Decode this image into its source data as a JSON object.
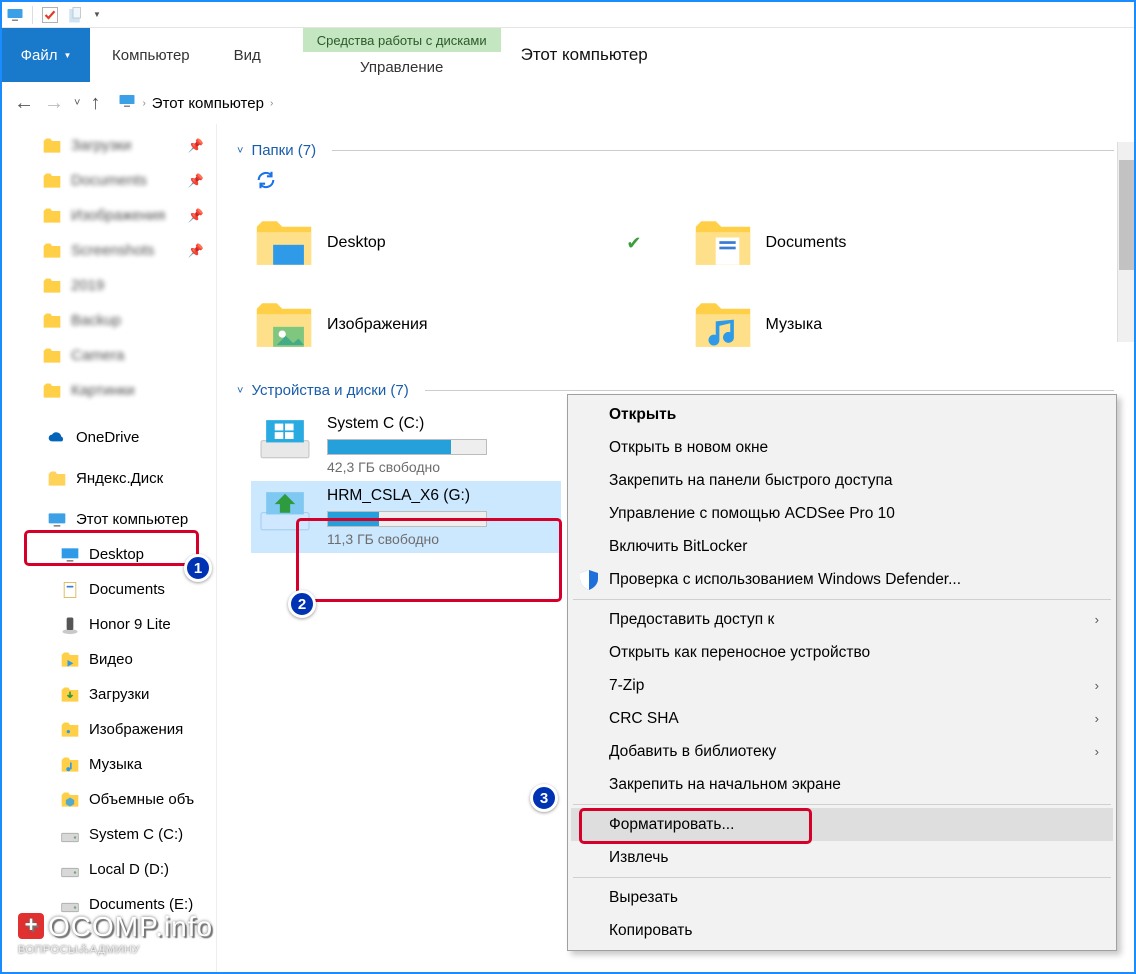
{
  "qab": {
    "icons": [
      "pc",
      "check",
      "paste"
    ]
  },
  "ribbon": {
    "file": "Файл",
    "tabs": [
      "Компьютер",
      "Вид"
    ],
    "context_title": "Средства работы с дисками",
    "context_tab": "Управление",
    "window_title": "Этот компьютер"
  },
  "breadcrumb": {
    "root": "Этот компьютер"
  },
  "sidebar": {
    "quick": [
      {
        "label": "Загрузки",
        "icon": "folder",
        "pinned": true,
        "blur": true
      },
      {
        "label": "Documents",
        "icon": "folder",
        "pinned": true,
        "blur": true
      },
      {
        "label": "Изображения",
        "icon": "folder",
        "pinned": true,
        "blur": true
      },
      {
        "label": "Screenshots",
        "icon": "folder",
        "pinned": true,
        "blur": true
      },
      {
        "label": "2019",
        "icon": "folder",
        "pinned": false,
        "blur": true
      },
      {
        "label": "Backup",
        "icon": "folder",
        "pinned": false,
        "blur": true
      },
      {
        "label": "Camera",
        "icon": "folder",
        "pinned": false,
        "blur": true
      },
      {
        "label": "Картинки",
        "icon": "folder",
        "pinned": false,
        "blur": true
      }
    ],
    "onedrive": "OneDrive",
    "yadisk": "Яндекс.Диск",
    "thispc": "Этот компьютер",
    "thispc_children": [
      {
        "label": "Desktop",
        "icon": "desktop"
      },
      {
        "label": "Documents",
        "icon": "documents"
      },
      {
        "label": "Honor 9 Lite",
        "icon": "phone"
      },
      {
        "label": "Видео",
        "icon": "video"
      },
      {
        "label": "Загрузки",
        "icon": "downloads"
      },
      {
        "label": "Изображения",
        "icon": "pictures"
      },
      {
        "label": "Музыка",
        "icon": "music"
      },
      {
        "label": "Объемные объ",
        "icon": "3d"
      },
      {
        "label": "System C (C:)",
        "icon": "drive"
      },
      {
        "label": "Local D (D:)",
        "icon": "drive"
      },
      {
        "label": "Documents (E:)",
        "icon": "drive"
      }
    ]
  },
  "folders_header": "Папки (7)",
  "folders": [
    {
      "name": "Desktop",
      "icon": "desktop",
      "badge": "ok"
    },
    {
      "name": "Documents",
      "icon": "documents"
    },
    {
      "name": "Изображения",
      "icon": "pictures"
    },
    {
      "name": "Музыка",
      "icon": "music"
    }
  ],
  "drives_header": "Устройства и диски (7)",
  "drives": [
    {
      "name": "System C (C:)",
      "free": "42,3 ГБ свободно",
      "fill_pct": 78,
      "icon": "win",
      "selected": false
    },
    {
      "name": "HRM_CSLA_X6 (G:)",
      "free": "11,3 ГБ свободно",
      "fill_pct": 32,
      "icon": "install",
      "selected": true
    }
  ],
  "ctxmenu": [
    {
      "label": "Открыть",
      "bold": true
    },
    {
      "label": "Открыть в новом окне"
    },
    {
      "label": "Закрепить на панели быстрого доступа"
    },
    {
      "label": "Управление с помощью ACDSee Pro 10"
    },
    {
      "label": "Включить BitLocker"
    },
    {
      "label": "Проверка с использованием Windows Defender...",
      "icon": "shield"
    },
    {
      "sep": true
    },
    {
      "label": "Предоставить доступ к",
      "sub": true
    },
    {
      "label": "Открыть как переносное устройство"
    },
    {
      "label": "7-Zip",
      "sub": true
    },
    {
      "label": "CRC SHA",
      "sub": true
    },
    {
      "label": "Добавить в библиотеку",
      "sub": true
    },
    {
      "label": "Закрепить на начальном экране"
    },
    {
      "sep": true
    },
    {
      "label": "Форматировать...",
      "highlight": true,
      "hover": true
    },
    {
      "label": "Извлечь"
    },
    {
      "sep": true
    },
    {
      "label": "Вырезать"
    },
    {
      "label": "Копировать"
    }
  ],
  "badges": {
    "b1": "1",
    "b2": "2",
    "b3": "3"
  },
  "watermark": {
    "big": "OCOMP.info",
    "small": "ВОПРОСЫ⁂АДМИНУ"
  }
}
